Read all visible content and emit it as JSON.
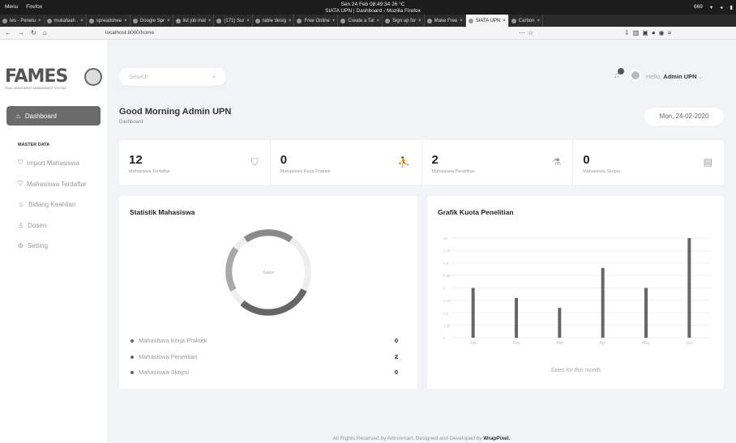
{
  "os_bar": {
    "menu_label": "Menu",
    "browser_label": "Firefox",
    "datetime": "Sen 24 Feb 08:49:34",
    "weather": "26 °C",
    "window_title": "SIATA UPN | Dashboard - Mozilla Firefox",
    "tray": "669"
  },
  "tabs": [
    {
      "label": "tes - Penelu"
    },
    {
      "label": "mukafaah ."
    },
    {
      "label": "spreadshee"
    },
    {
      "label": "Google Spr"
    },
    {
      "label": "list job mal"
    },
    {
      "label": "(171) Sur"
    },
    {
      "label": "table desig"
    },
    {
      "label": "Free Online"
    },
    {
      "label": "Create a Tal"
    },
    {
      "label": "Sign up for"
    },
    {
      "label": "Make Free"
    },
    {
      "label": "SIATA UPN",
      "active": true
    },
    {
      "label": "Carbon"
    }
  ],
  "url": "localhost:8000/home",
  "logo": {
    "text": "FAMES",
    "subtitle": "FINAL ASSIGNMENT MANAGEMENT SYSTEM"
  },
  "sidebar": {
    "dashboard": "Dashboard",
    "section": "MASTER DATA",
    "items": [
      {
        "label": "Import Mahasiswa"
      },
      {
        "label": "Mahasiswa Terdaftar"
      },
      {
        "label": "Bidang Keahlian"
      },
      {
        "label": "Dosen"
      },
      {
        "label": "Setting"
      }
    ]
  },
  "search": {
    "placeholder": "Search"
  },
  "user": {
    "hello": "Hello,",
    "name": "Admin UPN"
  },
  "greeting": "Good Morning Admin UPN",
  "breadcrumb": "Dashboard",
  "date": "Mon, 24-02-2020",
  "stats": [
    {
      "value": "12",
      "label": "Mahasiswa Terdaftar",
      "icon": "graduation-cap-icon"
    },
    {
      "value": "0",
      "label": "Mahasiswa Kerja Praktek",
      "icon": "worker-icon"
    },
    {
      "value": "2",
      "label": "Mahasiswa Penelitian",
      "icon": "flask-icon"
    },
    {
      "value": "0",
      "label": "Mahasiswa Skripsi",
      "icon": "book-icon"
    }
  ],
  "statistik": {
    "title": "Statistik Mahasiswa",
    "center_label": "Sales",
    "legend": [
      {
        "label": "Mahasiswa Kerja Praktek",
        "value": "0"
      },
      {
        "label": "Mahasiswa Penelitian",
        "value": "2"
      },
      {
        "label": "Mahasiswa Skripsi",
        "value": "0"
      }
    ]
  },
  "grafik": {
    "title": "Grafik Kuota Penelitian",
    "caption": "Sales for this month"
  },
  "chart_data": {
    "type": "bar",
    "categories": [
      "Jan",
      "Feb",
      "Mar",
      "Apr",
      "May",
      "Jun"
    ],
    "values": [
      5,
      4,
      3,
      7,
      5,
      10
    ],
    "yticks": [
      "0",
      "1.25",
      "2.5",
      "3.75",
      "5",
      "6.25",
      "7.5",
      "8.75",
      "10"
    ],
    "ylim": [
      0,
      10
    ],
    "grid": true,
    "bar_color": "#666666"
  },
  "footer": {
    "text": "All Rights Reserved by Adminmart. Designed and Developed by",
    "brand": "WrapPixel."
  }
}
